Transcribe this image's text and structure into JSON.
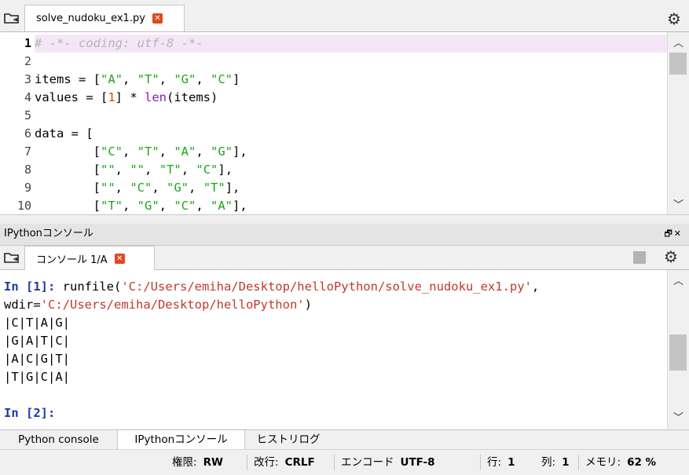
{
  "editor": {
    "tab_label": "solve_nudoku_ex1.py",
    "lines": [
      {
        "n": "1",
        "html": "<span class=\"cmt\"># -*- coding: utf-8 -*-</span>"
      },
      {
        "n": "2",
        "html": ""
      },
      {
        "n": "3",
        "html": "items = [<span class=\"str\">\"A\"</span>, <span class=\"str\">\"T\"</span>, <span class=\"str\">\"G\"</span>, <span class=\"str\">\"C\"</span>]"
      },
      {
        "n": "4",
        "html": "values = [<span class=\"num\">1</span>] * <span class=\"builtin\">len</span>(items)"
      },
      {
        "n": "5",
        "html": ""
      },
      {
        "n": "6",
        "html": "data = ["
      },
      {
        "n": "7",
        "html": "        [<span class=\"str\">\"C\"</span>, <span class=\"str\">\"T\"</span>, <span class=\"str\">\"A\"</span>, <span class=\"str\">\"G\"</span>],"
      },
      {
        "n": "8",
        "html": "        [<span class=\"str\">\"\"</span>, <span class=\"str\">\"\"</span>, <span class=\"str\">\"T\"</span>, <span class=\"str\">\"C\"</span>],"
      },
      {
        "n": "9",
        "html": "        [<span class=\"str\">\"\"</span>, <span class=\"str\">\"C\"</span>, <span class=\"str\">\"G\"</span>, <span class=\"str\">\"T\"</span>],"
      },
      {
        "n": "10",
        "html": "        [<span class=\"str\">\"T\"</span>, <span class=\"str\">\"G\"</span>, <span class=\"str\">\"C\"</span>, <span class=\"str\">\"A\"</span>],"
      }
    ]
  },
  "panel": {
    "title": "IPythonコンソール",
    "console_tab_label": "コンソール 1/A"
  },
  "console": {
    "lines": [
      {
        "html": "<span class=\"prompt\">In [1]:</span> runfile(<span class=\"cstr\">'C:/Users/emiha/Desktop/helloPython/solve_nudoku_ex1.py'</span>,"
      },
      {
        "html": "wdir=<span class=\"cstr\">'C:/Users/emiha/Desktop/helloPython'</span>)"
      },
      {
        "html": "|C|T|A|G|"
      },
      {
        "html": "|G|A|T|C|"
      },
      {
        "html": "|A|C|G|T|"
      },
      {
        "html": "|T|G|C|A|"
      },
      {
        "html": ""
      },
      {
        "html": "<span class=\"prompt\">In [2]:</span>"
      }
    ]
  },
  "bottom_tabs": [
    "Python console",
    "IPythonコンソール",
    "ヒストリログ"
  ],
  "status": {
    "perm_label": "権限:",
    "perm_value": "RW",
    "eol_label": "改行:",
    "eol_value": "CRLF",
    "enc_label": "エンコード",
    "enc_value": "UTF-8",
    "line_label": "行:",
    "line_value": "1",
    "col_label": "列:",
    "col_value": "1",
    "mem_label": "メモリ:",
    "mem_value": "62 %"
  },
  "icons": {
    "browse": "folder-browse-icon",
    "options": "gear-icon",
    "close": "close-tab-icon",
    "stop": "stop-icon"
  },
  "colors": {
    "string": "#1aa81a",
    "comment": "#b4b4b4",
    "number": "#b35a00",
    "builtin": "#8a1ba8",
    "prompt": "#1c3aa5",
    "console_string": "#c0392b",
    "close_badge": "#e2461f",
    "current_line": "#f5e6f7"
  }
}
